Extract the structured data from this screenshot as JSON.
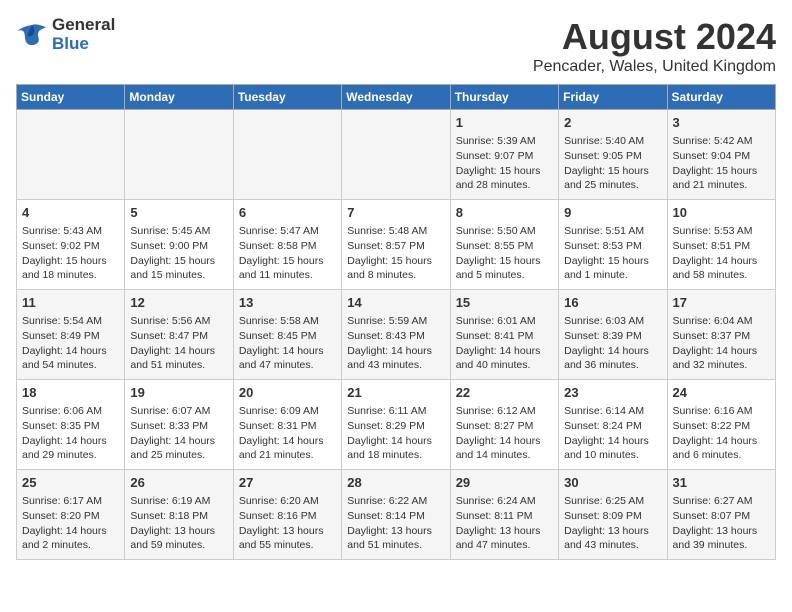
{
  "header": {
    "logo_line1": "General",
    "logo_line2": "Blue",
    "main_title": "August 2024",
    "subtitle": "Pencader, Wales, United Kingdom"
  },
  "days_of_week": [
    "Sunday",
    "Monday",
    "Tuesday",
    "Wednesday",
    "Thursday",
    "Friday",
    "Saturday"
  ],
  "weeks": [
    [
      {
        "day": "",
        "content": ""
      },
      {
        "day": "",
        "content": ""
      },
      {
        "day": "",
        "content": ""
      },
      {
        "day": "",
        "content": ""
      },
      {
        "day": "1",
        "content": "Sunrise: 5:39 AM\nSunset: 9:07 PM\nDaylight: 15 hours\nand 28 minutes."
      },
      {
        "day": "2",
        "content": "Sunrise: 5:40 AM\nSunset: 9:05 PM\nDaylight: 15 hours\nand 25 minutes."
      },
      {
        "day": "3",
        "content": "Sunrise: 5:42 AM\nSunset: 9:04 PM\nDaylight: 15 hours\nand 21 minutes."
      }
    ],
    [
      {
        "day": "4",
        "content": "Sunrise: 5:43 AM\nSunset: 9:02 PM\nDaylight: 15 hours\nand 18 minutes."
      },
      {
        "day": "5",
        "content": "Sunrise: 5:45 AM\nSunset: 9:00 PM\nDaylight: 15 hours\nand 15 minutes."
      },
      {
        "day": "6",
        "content": "Sunrise: 5:47 AM\nSunset: 8:58 PM\nDaylight: 15 hours\nand 11 minutes."
      },
      {
        "day": "7",
        "content": "Sunrise: 5:48 AM\nSunset: 8:57 PM\nDaylight: 15 hours\nand 8 minutes."
      },
      {
        "day": "8",
        "content": "Sunrise: 5:50 AM\nSunset: 8:55 PM\nDaylight: 15 hours\nand 5 minutes."
      },
      {
        "day": "9",
        "content": "Sunrise: 5:51 AM\nSunset: 8:53 PM\nDaylight: 15 hours\nand 1 minute."
      },
      {
        "day": "10",
        "content": "Sunrise: 5:53 AM\nSunset: 8:51 PM\nDaylight: 14 hours\nand 58 minutes."
      }
    ],
    [
      {
        "day": "11",
        "content": "Sunrise: 5:54 AM\nSunset: 8:49 PM\nDaylight: 14 hours\nand 54 minutes."
      },
      {
        "day": "12",
        "content": "Sunrise: 5:56 AM\nSunset: 8:47 PM\nDaylight: 14 hours\nand 51 minutes."
      },
      {
        "day": "13",
        "content": "Sunrise: 5:58 AM\nSunset: 8:45 PM\nDaylight: 14 hours\nand 47 minutes."
      },
      {
        "day": "14",
        "content": "Sunrise: 5:59 AM\nSunset: 8:43 PM\nDaylight: 14 hours\nand 43 minutes."
      },
      {
        "day": "15",
        "content": "Sunrise: 6:01 AM\nSunset: 8:41 PM\nDaylight: 14 hours\nand 40 minutes."
      },
      {
        "day": "16",
        "content": "Sunrise: 6:03 AM\nSunset: 8:39 PM\nDaylight: 14 hours\nand 36 minutes."
      },
      {
        "day": "17",
        "content": "Sunrise: 6:04 AM\nSunset: 8:37 PM\nDaylight: 14 hours\nand 32 minutes."
      }
    ],
    [
      {
        "day": "18",
        "content": "Sunrise: 6:06 AM\nSunset: 8:35 PM\nDaylight: 14 hours\nand 29 minutes."
      },
      {
        "day": "19",
        "content": "Sunrise: 6:07 AM\nSunset: 8:33 PM\nDaylight: 14 hours\nand 25 minutes."
      },
      {
        "day": "20",
        "content": "Sunrise: 6:09 AM\nSunset: 8:31 PM\nDaylight: 14 hours\nand 21 minutes."
      },
      {
        "day": "21",
        "content": "Sunrise: 6:11 AM\nSunset: 8:29 PM\nDaylight: 14 hours\nand 18 minutes."
      },
      {
        "day": "22",
        "content": "Sunrise: 6:12 AM\nSunset: 8:27 PM\nDaylight: 14 hours\nand 14 minutes."
      },
      {
        "day": "23",
        "content": "Sunrise: 6:14 AM\nSunset: 8:24 PM\nDaylight: 14 hours\nand 10 minutes."
      },
      {
        "day": "24",
        "content": "Sunrise: 6:16 AM\nSunset: 8:22 PM\nDaylight: 14 hours\nand 6 minutes."
      }
    ],
    [
      {
        "day": "25",
        "content": "Sunrise: 6:17 AM\nSunset: 8:20 PM\nDaylight: 14 hours\nand 2 minutes."
      },
      {
        "day": "26",
        "content": "Sunrise: 6:19 AM\nSunset: 8:18 PM\nDaylight: 13 hours\nand 59 minutes."
      },
      {
        "day": "27",
        "content": "Sunrise: 6:20 AM\nSunset: 8:16 PM\nDaylight: 13 hours\nand 55 minutes."
      },
      {
        "day": "28",
        "content": "Sunrise: 6:22 AM\nSunset: 8:14 PM\nDaylight: 13 hours\nand 51 minutes."
      },
      {
        "day": "29",
        "content": "Sunrise: 6:24 AM\nSunset: 8:11 PM\nDaylight: 13 hours\nand 47 minutes."
      },
      {
        "day": "30",
        "content": "Sunrise: 6:25 AM\nSunset: 8:09 PM\nDaylight: 13 hours\nand 43 minutes."
      },
      {
        "day": "31",
        "content": "Sunrise: 6:27 AM\nSunset: 8:07 PM\nDaylight: 13 hours\nand 39 minutes."
      }
    ]
  ]
}
